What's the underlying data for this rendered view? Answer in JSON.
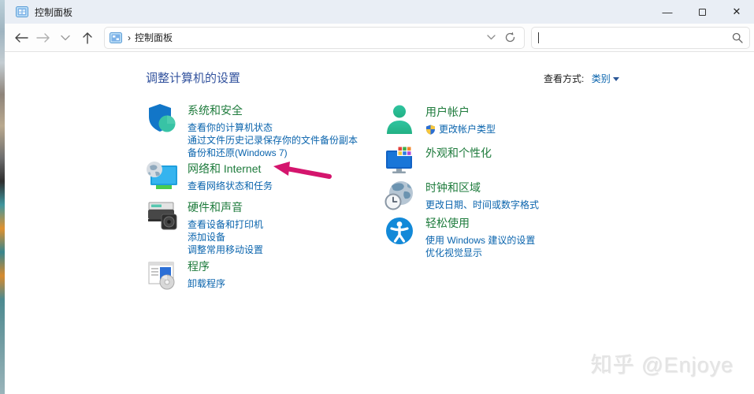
{
  "window": {
    "title": "控制面板",
    "controls": {
      "minimize": "—",
      "close": "✕"
    }
  },
  "toolbar": {
    "breadcrumb_root": "控制面板",
    "breadcrumb_separator": "›",
    "search": {
      "value": "",
      "placeholder": ""
    }
  },
  "page": {
    "heading": "调整计算机的设置",
    "view_by_label": "查看方式:",
    "view_by_value": "类别"
  },
  "categories": {
    "left": [
      {
        "title": "系统和安全",
        "links": [
          "查看你的计算机状态",
          "通过文件历史记录保存你的文件备份副本",
          "备份和还原(Windows 7)"
        ]
      },
      {
        "title": "网络和 Internet",
        "links": [
          "查看网络状态和任务"
        ]
      },
      {
        "title": "硬件和声音",
        "links": [
          "查看设备和打印机",
          "添加设备",
          "调整常用移动设置"
        ]
      },
      {
        "title": "程序",
        "links": [
          "卸载程序"
        ]
      }
    ],
    "right": [
      {
        "title": "用户帐户",
        "links": [
          "更改帐户类型"
        ]
      },
      {
        "title": "外观和个性化",
        "links": []
      },
      {
        "title": "时钟和区域",
        "links": [
          "更改日期、时间或数字格式"
        ]
      },
      {
        "title": "轻松使用",
        "links": [
          "使用 Windows 建议的设置",
          "优化视觉显示"
        ]
      }
    ]
  },
  "annotation": {
    "arrow_color": "#d4156d",
    "arrow_target": "网络和 Internet"
  },
  "colors": {
    "category_title": "#1e7b3c",
    "task_link": "#0a64ad",
    "heading": "#33539e",
    "titlebar": "#e9eef5"
  },
  "watermark": "知乎 @Enjoye"
}
